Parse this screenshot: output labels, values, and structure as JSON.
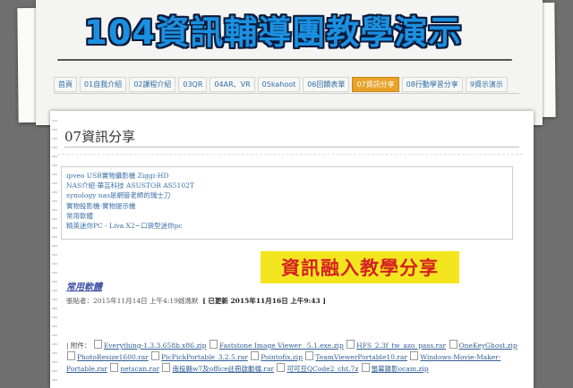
{
  "header": {
    "title": "104資訊輔導團教學演示"
  },
  "nav": {
    "items": [
      {
        "label": "首頁"
      },
      {
        "label": "01自我介紹"
      },
      {
        "label": "02課程介紹"
      },
      {
        "label": "03QR"
      },
      {
        "label": "04AR、VR"
      },
      {
        "label": "05kahoot"
      },
      {
        "label": "06回饋表單"
      },
      {
        "label": "07資訊分享",
        "active": true
      },
      {
        "label": "08行動學習分享"
      },
      {
        "label": "9資示演示"
      }
    ]
  },
  "page": {
    "title": "07資訊分享"
  },
  "links": [
    "ipveo USB實物攝影機 Ziggi-HD",
    "NAS介紹-華芸科技 ASUSTOR AS5102T",
    "synology nas是網管老師的瑞士刀",
    "實物投影機-實物提示機",
    "常用軟體",
    "精英迷你PC - Liva X2~口袋型迷你pc"
  ],
  "banner": {
    "text": "資訊融入教學分享"
  },
  "post": {
    "title": "常用軟體",
    "meta_posted": "張貼者：2015年11月14日 上午4:19姚逸默",
    "meta_updated": "[ 已更新 2015年11月16日 上午9:43 ]"
  },
  "attachments": {
    "label": "附件：",
    "files": [
      "Everything-1.3.3.658b.x86.zip",
      "Faststone Image Viewer _5.1.exe.zip",
      "HFS_2.3f_tw_azo_pass.rar",
      "OneKeyGhost.zip",
      "PhotoResize1600.rar",
      "PicPickPortable_3.2.5.rar",
      "Pointofix.zip",
      "TeamViewerPortable10.rar",
      "Windows-Movie-Maker-Portable.rar",
      "netscan.rar",
      "南投縣w7及office註冊啟動檔.rar",
      "可可豆QCode2_cht.7z",
      "螢幕錄影ocam.zip"
    ]
  }
}
